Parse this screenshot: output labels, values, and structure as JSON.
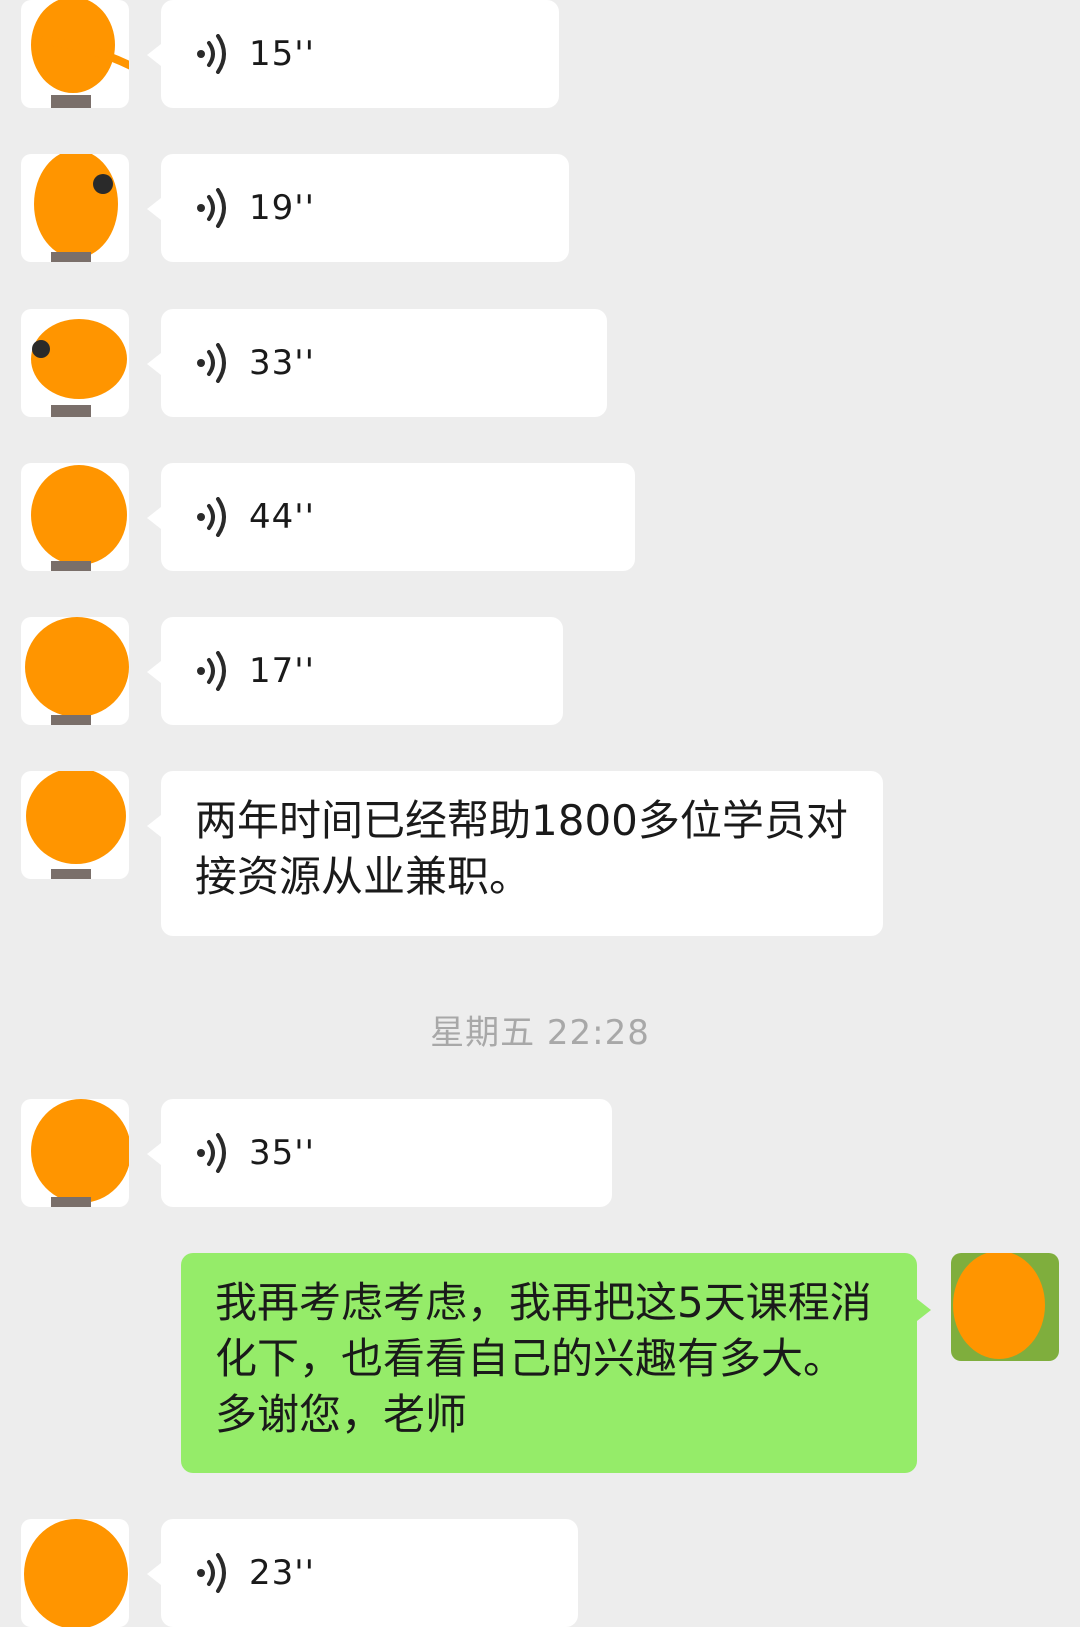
{
  "chat": {
    "messages": [
      {
        "type": "voice",
        "side": "left",
        "duration": "15''"
      },
      {
        "type": "voice",
        "side": "left",
        "duration": "19''"
      },
      {
        "type": "voice",
        "side": "left",
        "duration": "33''"
      },
      {
        "type": "voice",
        "side": "left",
        "duration": "44''"
      },
      {
        "type": "voice",
        "side": "left",
        "duration": "17''"
      },
      {
        "type": "text",
        "side": "left",
        "text": "两年时间已经帮助1800多位学员对接资源从业兼职。"
      },
      {
        "type": "timestamp",
        "text": "星期五 22:28"
      },
      {
        "type": "voice",
        "side": "left",
        "duration": "35''"
      },
      {
        "type": "text",
        "side": "right",
        "text": "我再考虑考虑，我再把这5天课程消化下，也看看自己的兴趣有多大。多谢您，老师"
      },
      {
        "type": "voice",
        "side": "left",
        "duration": "23''"
      }
    ]
  },
  "colors": {
    "background": "#ededed",
    "incoming_bubble": "#ffffff",
    "outgoing_bubble": "#95ec69",
    "avatar_scribble": "#ff9500",
    "timestamp_text": "#a8a8a8"
  },
  "icons": {
    "voice": "voice-wave-icon"
  }
}
